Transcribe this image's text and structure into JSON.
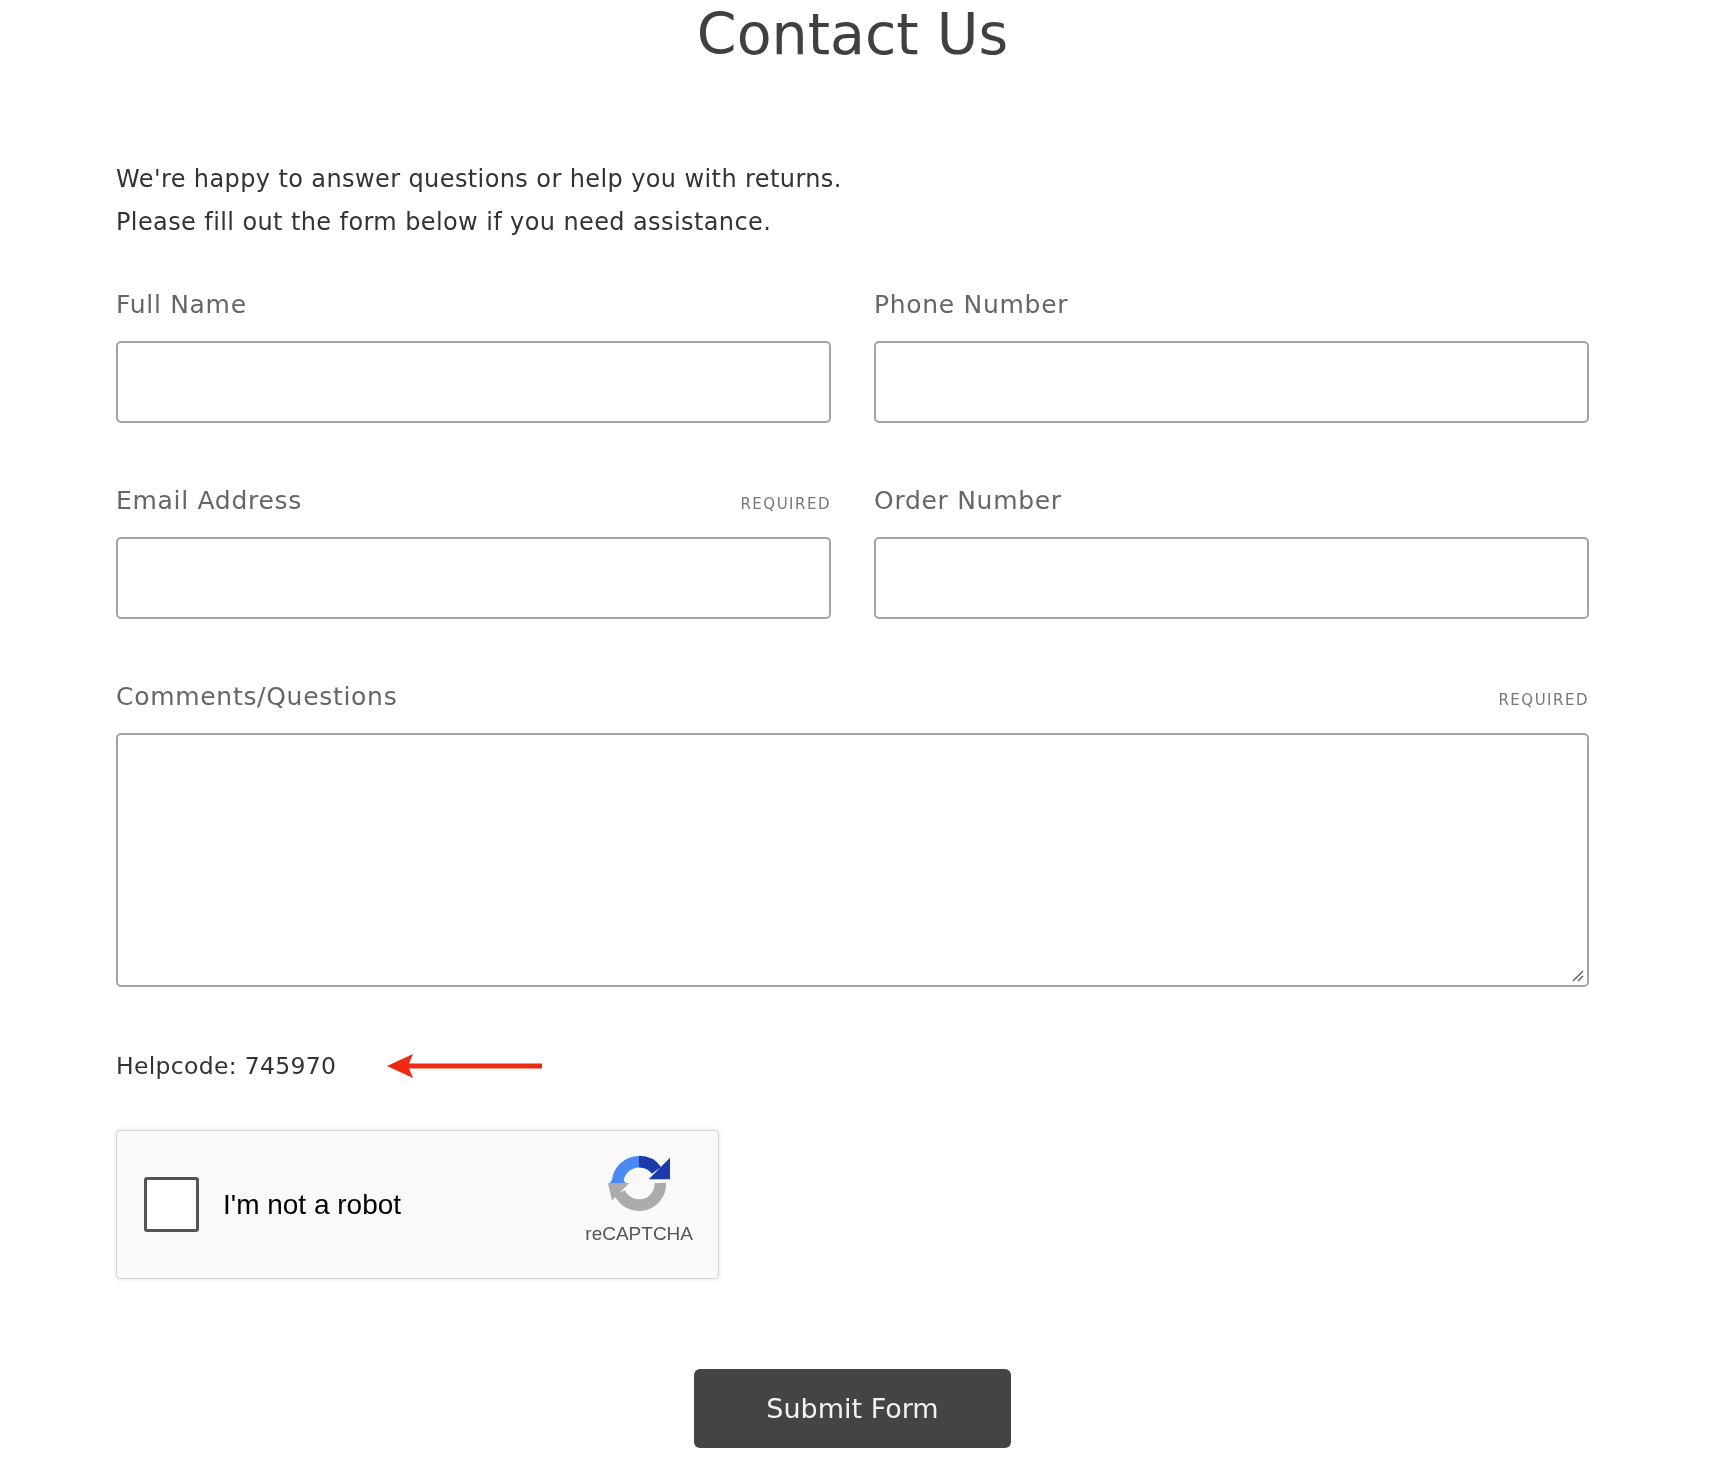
{
  "title": "Contact Us",
  "intro": [
    "We're happy to answer questions or help you with returns.",
    "Please fill out the form below if you need assistance."
  ],
  "fields": [
    {
      "kind": "input",
      "label": "Full Name"
    },
    {
      "kind": "input",
      "label": "Phone Number"
    },
    {
      "kind": "input",
      "label": "Email Address",
      "required_tag": "REQUIRED"
    },
    {
      "kind": "input",
      "label": "Order Number"
    },
    {
      "kind": "textarea",
      "label": "Comments/Questions",
      "required_tag": "REQUIRED"
    }
  ],
  "helpcode": "Helpcode: 745970",
  "captcha": {
    "label": "I'm not a robot",
    "checked": false,
    "brand": "reCAPTCHA"
  },
  "submit": "Submit Form"
}
